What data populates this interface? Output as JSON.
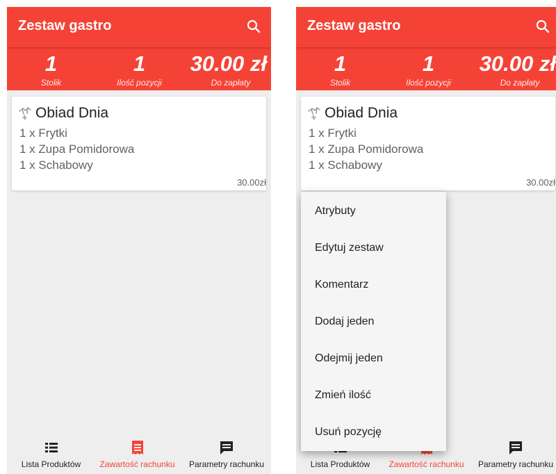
{
  "app": {
    "title": "Zestaw gastro"
  },
  "summary": {
    "table_number": "1",
    "table_label": "Stolik",
    "items_count": "1",
    "items_label": "Ilość pozycji",
    "amount_due": "30.00 zł",
    "amount_label": "Do zapłaty"
  },
  "order": {
    "title": "Obiad Dnia",
    "items": [
      "1 x Frytki",
      "1 x Zupa Pomidorowa",
      "1 x Schabowy"
    ],
    "price": "30.00zł"
  },
  "bottom_nav": {
    "tabs": [
      {
        "label": "Lista Produktów",
        "icon": "list-icon"
      },
      {
        "label": "Zawartość rachunku",
        "icon": "receipt-icon",
        "active": true
      },
      {
        "label": "Parametry rachunku",
        "icon": "comment-icon"
      }
    ]
  },
  "context_menu": {
    "items": [
      "Atrybuty",
      "Edytuj zestaw",
      "Komentarz",
      "Dodaj jeden",
      "Odejmij jeden",
      "Zmień ilość",
      "Usuń pozycję"
    ]
  },
  "colors": {
    "primary": "#f44336",
    "background": "#eeeeee",
    "text": "#212121",
    "secondary_text": "#616161"
  }
}
